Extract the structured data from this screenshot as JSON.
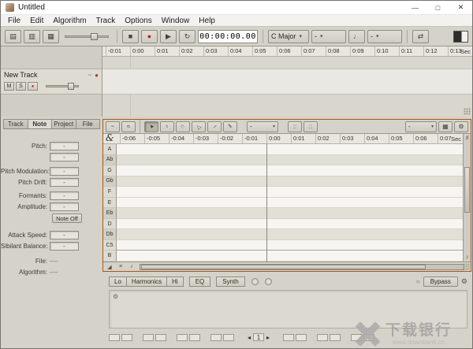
{
  "window": {
    "title": "Untitled",
    "minimize": "—",
    "maximize": "□",
    "close": "✕"
  },
  "menu": {
    "items": [
      "File",
      "Edit",
      "Algorithm",
      "Track",
      "Options",
      "Window",
      "Help"
    ]
  },
  "toolbar": {
    "view_buttons": [
      {
        "name": "arrangement-view",
        "glyph": "▤"
      },
      {
        "name": "mixer-view",
        "glyph": "▥"
      },
      {
        "name": "meter-view",
        "glyph": "▦"
      }
    ],
    "transport": {
      "stop": "■",
      "play": "▶",
      "record": "●",
      "cycle": "↻"
    },
    "time_display": "00:00:00.00",
    "key": "C Major",
    "tempo": "-",
    "metronome": "♩",
    "reference": "-",
    "autoscroll": "⇄",
    "dropdown": "▾"
  },
  "track": {
    "name": "New Track",
    "mute": "M",
    "solo": "S",
    "record": "●",
    "melody_icon": "~",
    "arm_icon": "●"
  },
  "arrangement": {
    "ticks": [
      "-0:01",
      "0:00",
      "0:01",
      "0:02",
      "0:03",
      "0:04",
      "0:05",
      "0:06",
      "0:07",
      "0:08",
      "0:09",
      "0:10",
      "0:11",
      "0:12",
      "0:13"
    ],
    "unit": "Sec"
  },
  "inspector": {
    "tabs": [
      {
        "label": "Track"
      },
      {
        "label": "Note",
        "active": true
      },
      {
        "label": "Project"
      },
      {
        "label": "File"
      }
    ],
    "pitch_fields": [
      {
        "label": "Pitch:",
        "value": "-"
      },
      {
        "label": "",
        "value": "-"
      }
    ],
    "mod_fields": [
      {
        "label": "Pitch Modulation:",
        "value": "-"
      },
      {
        "label": "Pitch Drift:",
        "value": "-"
      }
    ],
    "tone_fields": [
      {
        "label": "Formants:",
        "value": "-"
      },
      {
        "label": "Amplitude:",
        "value": "-"
      }
    ],
    "note_off": "Note Off",
    "attack_fields": [
      {
        "label": "Attack Speed:",
        "value": "-"
      },
      {
        "label": "Sibilant Balance:",
        "value": "-"
      }
    ],
    "info_fields": [
      {
        "label": "File:",
        "value": "----"
      },
      {
        "label": "Algorithm:",
        "value": "----"
      }
    ]
  },
  "editor": {
    "macro_pitch": "~",
    "macro_time": "≈",
    "tools": [
      {
        "name": "main-tool",
        "glyph": "▲",
        "active": true
      },
      {
        "name": "pitch-tool",
        "glyph": "♪"
      },
      {
        "name": "formant-tool",
        "glyph": "∩"
      },
      {
        "name": "amplitude-tool",
        "glyph": "△"
      },
      {
        "name": "timing-tool",
        "glyph": "↔"
      },
      {
        "name": "separation-tool",
        "glyph": "‖"
      }
    ],
    "combo1": "-",
    "snap_pitch": "::",
    "snap_time": "::",
    "combo2": "-",
    "grid": "▦",
    "gear": "⚙",
    "clef": "&",
    "ticks": [
      "-0:06",
      "-0:05",
      "-0:04",
      "-0:03",
      "-0:02",
      "-0:01",
      "0:00",
      "0:01",
      "0:02",
      "0:03",
      "0:04",
      "0:05",
      "0:06",
      "0:07"
    ],
    "unit": "Sec",
    "rows": [
      {
        "label": "A"
      },
      {
        "label": "Ab",
        "flat": true
      },
      {
        "label": "G"
      },
      {
        "label": "Gb",
        "flat": true
      },
      {
        "label": "F"
      },
      {
        "label": "E"
      },
      {
        "label": "Eb",
        "flat": true
      },
      {
        "label": "D"
      },
      {
        "label": "Db",
        "flat": true
      },
      {
        "label": "C5",
        "octave": true
      },
      {
        "label": "B"
      }
    ],
    "bottom_icons": [
      {
        "name": "corner-tool-icon",
        "glyph": "◢"
      },
      {
        "name": "edit-tool-icon",
        "glyph": "≡"
      },
      {
        "name": "note-display-icon",
        "glyph": "♪"
      }
    ]
  },
  "sound": {
    "band_tabs": [
      "Lo",
      "Harmonics",
      "Hi"
    ],
    "eq_tab": "EQ",
    "synth_tab": "Synth",
    "level_icon": "○",
    "bypass": "Bypass",
    "gear": "⚙",
    "panel_gear": "⚙",
    "prev": "◂",
    "page": "1",
    "next": "▸"
  },
  "watermark": {
    "title": "下载银行",
    "url": "www.downbank.cn"
  }
}
